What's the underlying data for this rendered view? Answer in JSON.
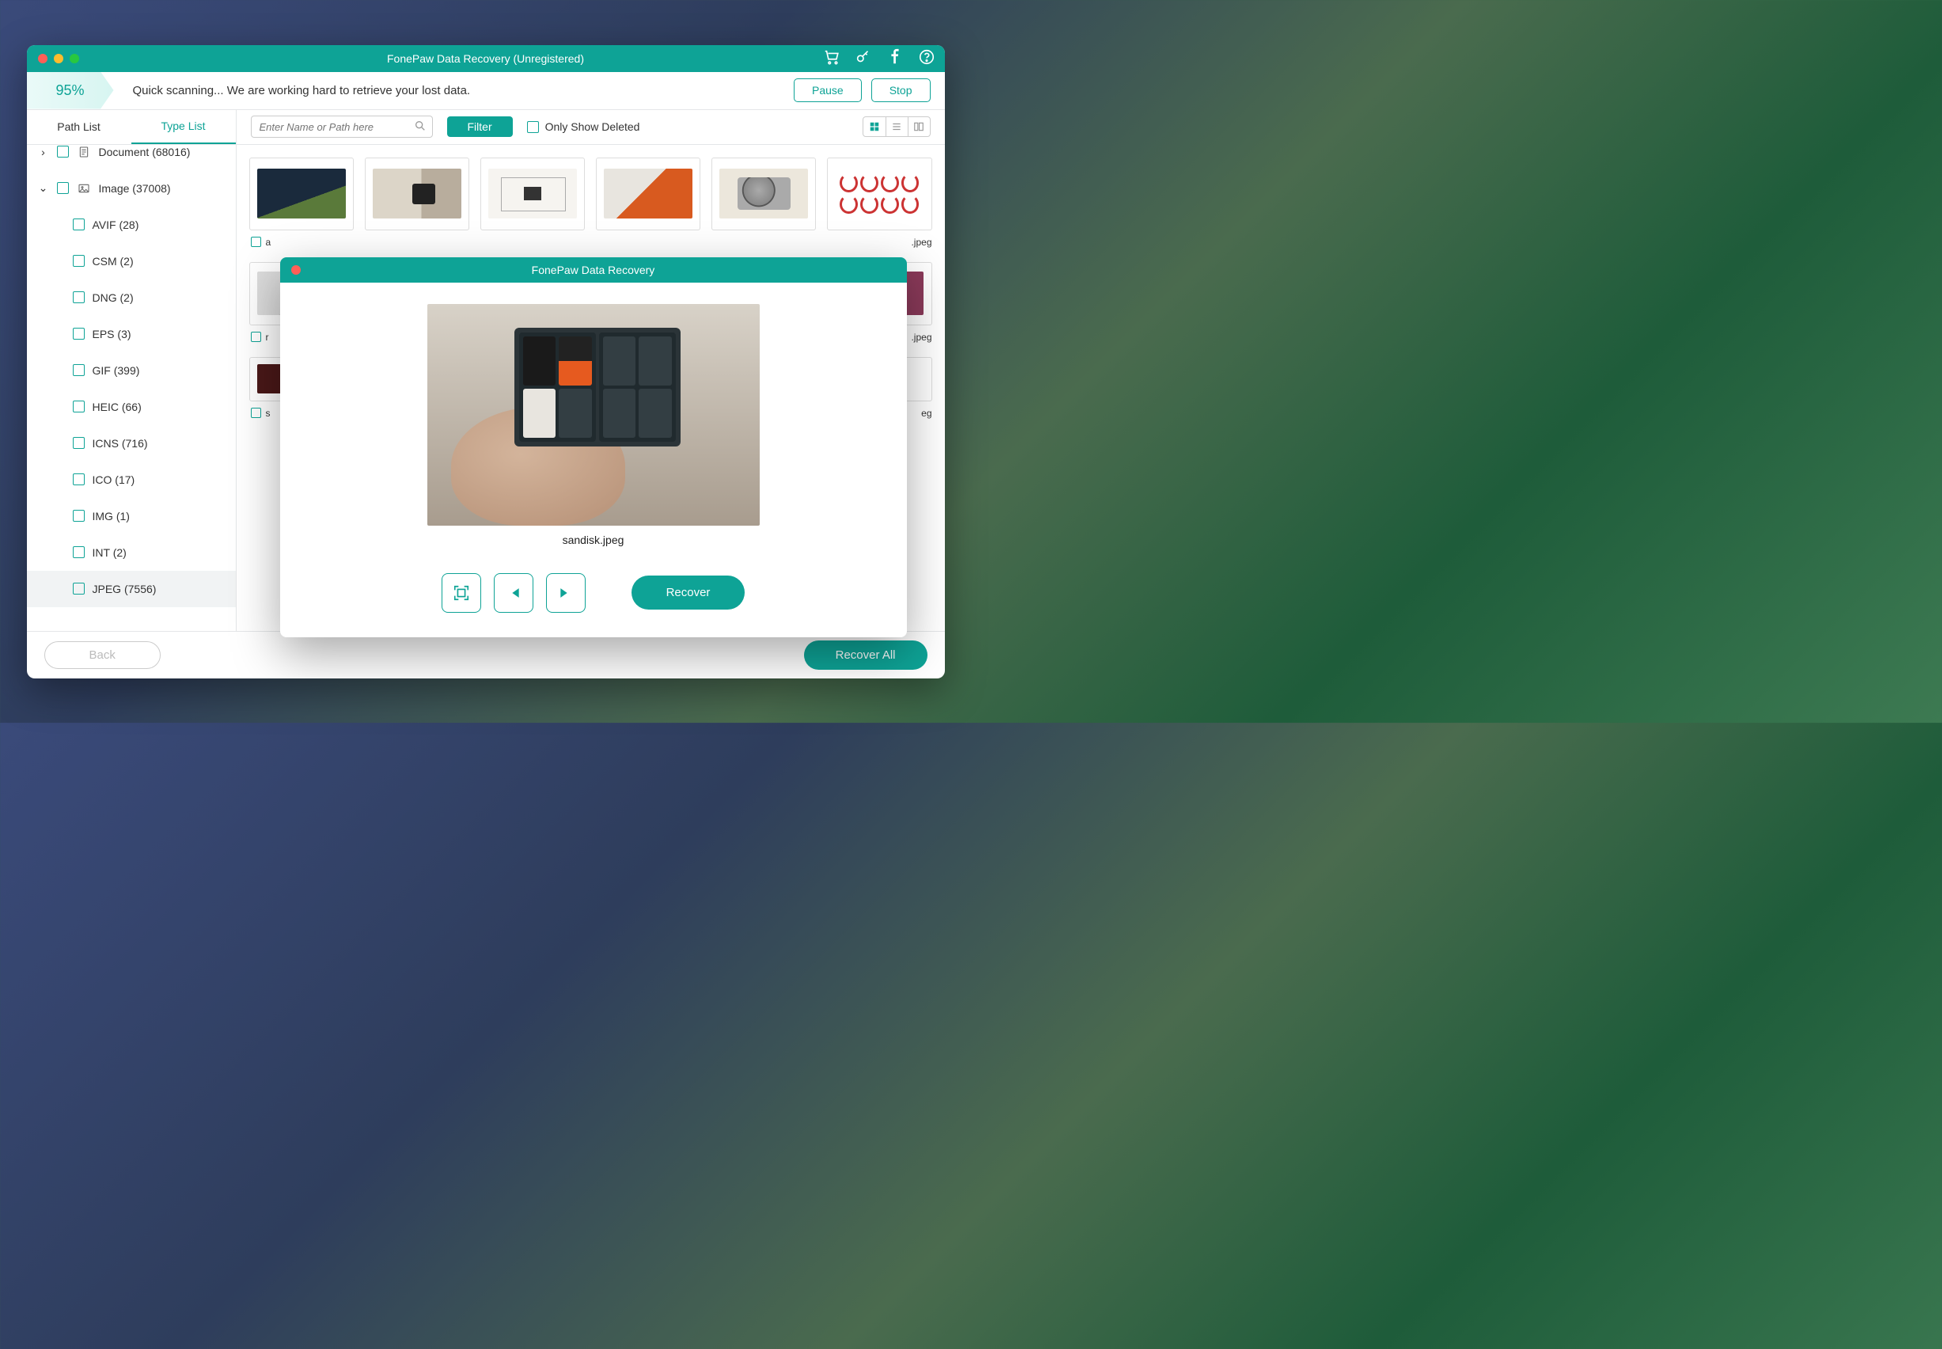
{
  "window": {
    "title": "FonePaw Data Recovery (Unregistered)"
  },
  "scan": {
    "percent": "95%",
    "status": "Quick scanning... We are working hard to retrieve your lost data.",
    "pause": "Pause",
    "stop": "Stop"
  },
  "tabs": {
    "path": "Path List",
    "type": "Type List"
  },
  "tree": {
    "document": "Document (68016)",
    "image": "Image (37008)",
    "items": [
      {
        "label": "AVIF (28)"
      },
      {
        "label": "CSM (2)"
      },
      {
        "label": "DNG (2)"
      },
      {
        "label": "EPS (3)"
      },
      {
        "label": "GIF (399)"
      },
      {
        "label": "HEIC (66)"
      },
      {
        "label": "ICNS (716)"
      },
      {
        "label": "ICO (17)"
      },
      {
        "label": "IMG (1)"
      },
      {
        "label": "INT (2)"
      },
      {
        "label": "JPEG (7556)"
      }
    ]
  },
  "toolbar": {
    "search_placeholder": "Enter Name or Path here",
    "filter": "Filter",
    "only_deleted": "Only Show Deleted"
  },
  "grid": {
    "row1_names": [
      "a",
      "",
      "",
      "",
      "",
      ".jpeg"
    ],
    "row2_name_left": "r",
    "row2_name_right": ".jpeg",
    "row3_name_left": "s",
    "row3_name_right": "eg"
  },
  "footer": {
    "back": "Back",
    "recover_all": "Recover All"
  },
  "preview": {
    "title": "FonePaw Data Recovery",
    "filename": "sandisk.jpeg",
    "recover": "Recover"
  }
}
